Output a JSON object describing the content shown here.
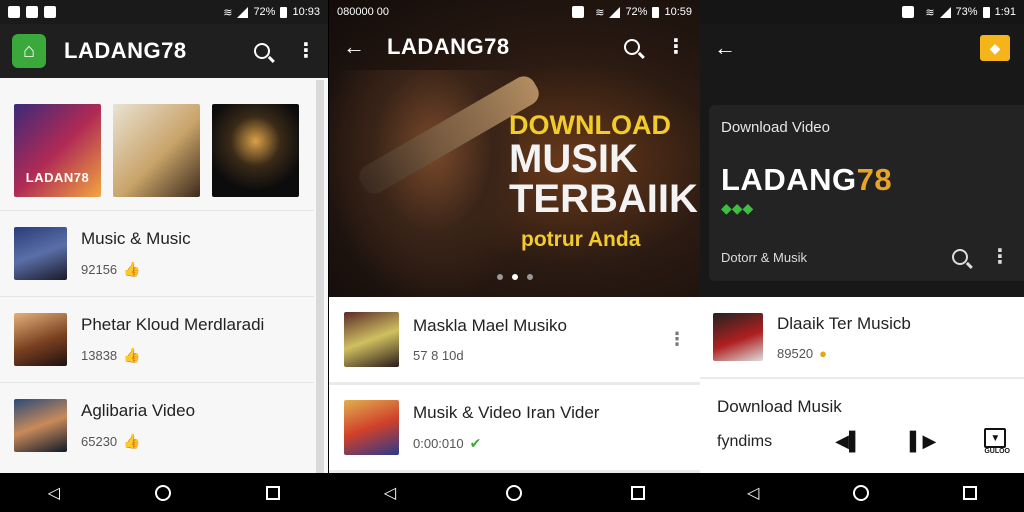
{
  "phone1": {
    "status_time": "10:93",
    "battery": "72%",
    "app_title": "LADANG78",
    "albums": [
      {
        "caption": "LADAN78"
      },
      {
        "caption": ""
      },
      {
        "caption": ""
      }
    ],
    "rows": [
      {
        "title": "Music & Music",
        "sub": "92156"
      },
      {
        "title": "Phetar Kloud Merdlaradi",
        "sub": "13838"
      },
      {
        "title": "Aglibaria Video",
        "sub": "65230"
      }
    ]
  },
  "phone2": {
    "status_left": "080000 00",
    "status_time": "10:59",
    "battery": "72%",
    "app_title": "LADANG78",
    "hero": {
      "line1": "DOWNLOAD",
      "line2": "MUSIK",
      "line3": "TERBAIIK",
      "line4": "potrur Anda"
    },
    "rows": [
      {
        "title": "Maskla Mael Musiko",
        "sub": "57 8 10d"
      },
      {
        "title": "Musik & Video Iran Vider",
        "sub": "0:00:010"
      }
    ]
  },
  "phone3": {
    "status_time": "1:91",
    "battery": "73%",
    "card": {
      "label": "Download Video",
      "brand_main": "LADANG",
      "brand_num": "78",
      "footer": "Dotorr & Musik"
    },
    "row": {
      "title": "Dlaaik Ter Musicb",
      "sub": "89520"
    },
    "download_label": "Download Musik",
    "controls_label": "fyndims",
    "ctrl_caption": "GULOO"
  }
}
